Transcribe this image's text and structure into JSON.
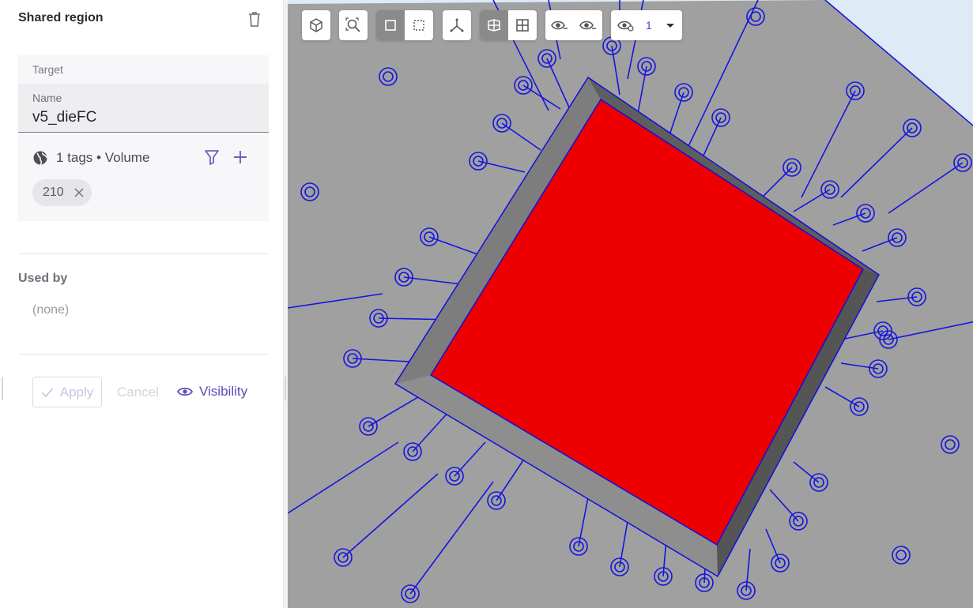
{
  "panel": {
    "title": "Shared region",
    "target_label": "Target",
    "name_label": "Name",
    "name_value": "v5_dieFC",
    "tags_summary": "1 tags • Volume",
    "tags": [
      "210"
    ],
    "used_by_title": "Used by",
    "used_by_value": "(none)",
    "apply_label": "Apply",
    "cancel_label": "Cancel",
    "visibility_label": "Visibility"
  },
  "toolbar": {
    "selection_count": "1"
  },
  "icons": {
    "delete": "trash-icon",
    "globe": "globe-icon",
    "filter": "filter-icon",
    "add": "plus-icon",
    "chip_remove": "close-icon",
    "apply": "check-icon",
    "visibility": "eye-icon"
  },
  "colors": {
    "accent": "#5b4bb5",
    "face_selected": "#ee0000",
    "body": "#a0a0a0",
    "edges": "#1010dd",
    "background": "#dfeaf7"
  }
}
